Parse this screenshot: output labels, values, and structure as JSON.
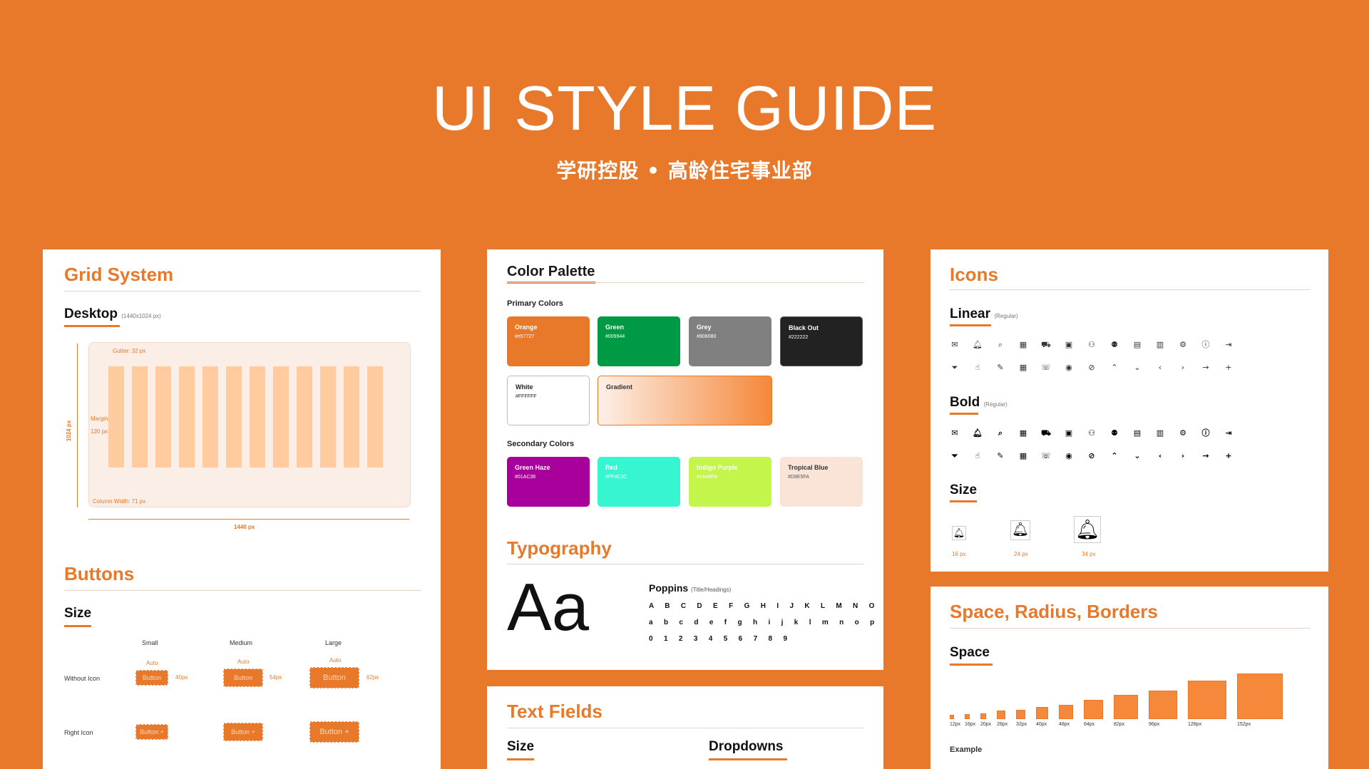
{
  "header": {
    "title": "UI STYLE GUIDE",
    "subtitle": "学研控股 • 高龄住宅事业部"
  },
  "grid": {
    "title": "Grid System",
    "desktop_label": "Desktop",
    "desktop_size": "(1440x1024 px)",
    "gutter": "Gutter: 32 px",
    "margin_label": "Margin",
    "margin_value": "120 px",
    "height_label": "1024 px",
    "column_width": "Column Width: 71 px",
    "width_label": "1440 px"
  },
  "buttons": {
    "title": "Buttons",
    "size_label": "Size",
    "columns": [
      "Small",
      "Medium",
      "Large"
    ],
    "rows": [
      "Without Icon",
      "Right Icon"
    ],
    "button_text": "Button",
    "auto": "Auto",
    "heights": [
      "40px",
      "54px",
      "62px"
    ]
  },
  "colors": {
    "title": "Color Palette",
    "primary_label": "Primary Colors",
    "secondary_label": "Secondary Colors",
    "primary": [
      {
        "name": "Orange",
        "hex": "#e57727",
        "color": "#E8782A"
      },
      {
        "name": "Green",
        "hex": "#009944",
        "color": "#009944"
      },
      {
        "name": "Grey",
        "hex": "#808080",
        "color": "#808080"
      },
      {
        "name": "Black Out",
        "hex": "#222222",
        "color": "#222222"
      },
      {
        "name": "White",
        "hex": "#FFFFFF",
        "color": "#FFFFFF"
      },
      {
        "name": "Gradient",
        "hex": "",
        "color": "#F5883A"
      }
    ],
    "secondary": [
      {
        "name": "Green Haze",
        "hex": "#01AC36",
        "color": "#A8009A"
      },
      {
        "name": "Red",
        "hex": "#FF4C3C",
        "color": "#38F5D2"
      },
      {
        "name": "Indigo Purple",
        "hex": "#4A40FB",
        "color": "#C3F54A"
      },
      {
        "name": "Tropical Blue",
        "hex": "#D8E5FA",
        "color": "#FAE4D8"
      }
    ]
  },
  "typography": {
    "title": "Typography",
    "sample": "Aa",
    "font_name": "Poppins",
    "font_role": "(Title/Headings)",
    "upper": "A B C D E F G H I J K L M N O P Q R S T U V W X Y Z",
    "lower": "a b c d e f g h i j k l m n o p q r s t u v w x y z",
    "digits": "0 1 2 3 4 5 6 7 8 9"
  },
  "textfields": {
    "title": "Text Fields",
    "size_label": "Size",
    "dropdowns_label": "Dropdowns"
  },
  "icons": {
    "title": "Icons",
    "linear_label": "Linear",
    "linear_style": "(Regular)",
    "bold_label": "Bold",
    "bold_style": "(Regular)",
    "size_label": "Size",
    "sizes": [
      "16 px",
      "24 px",
      "34 px"
    ],
    "row1": [
      "mail-icon",
      "bell-icon",
      "search-icon",
      "grid-icon",
      "cart-icon",
      "ticket-icon",
      "user-icon",
      "users-icon",
      "wallet-icon",
      "chart-icon",
      "settings-icon",
      "info-icon",
      "logout-icon"
    ],
    "row2": [
      "filter-icon",
      "like-icon",
      "pen-icon",
      "calendar-icon",
      "phone-icon",
      "eye-icon",
      "eye-off-icon",
      "chevron-up-icon",
      "chevron-down-icon",
      "chevron-left-icon",
      "chevron-right-icon",
      "arrow-right-icon",
      "plus-icon"
    ]
  },
  "space": {
    "title": "Space, Radius, Borders",
    "space_label": "Space",
    "example_label": "Example",
    "values": [
      {
        "label": "12px",
        "size": 12
      },
      {
        "label": "16px",
        "size": 16
      },
      {
        "label": "20px",
        "size": 20
      },
      {
        "label": "28px",
        "size": 28
      },
      {
        "label": "32px",
        "size": 32
      },
      {
        "label": "40px",
        "size": 40
      },
      {
        "label": "48px",
        "size": 48
      },
      {
        "label": "64px",
        "size": 64
      },
      {
        "label": "82px",
        "size": 82
      },
      {
        "label": "96px",
        "size": 96
      },
      {
        "label": "128px",
        "size": 128
      },
      {
        "label": "152px",
        "size": 152
      }
    ]
  }
}
